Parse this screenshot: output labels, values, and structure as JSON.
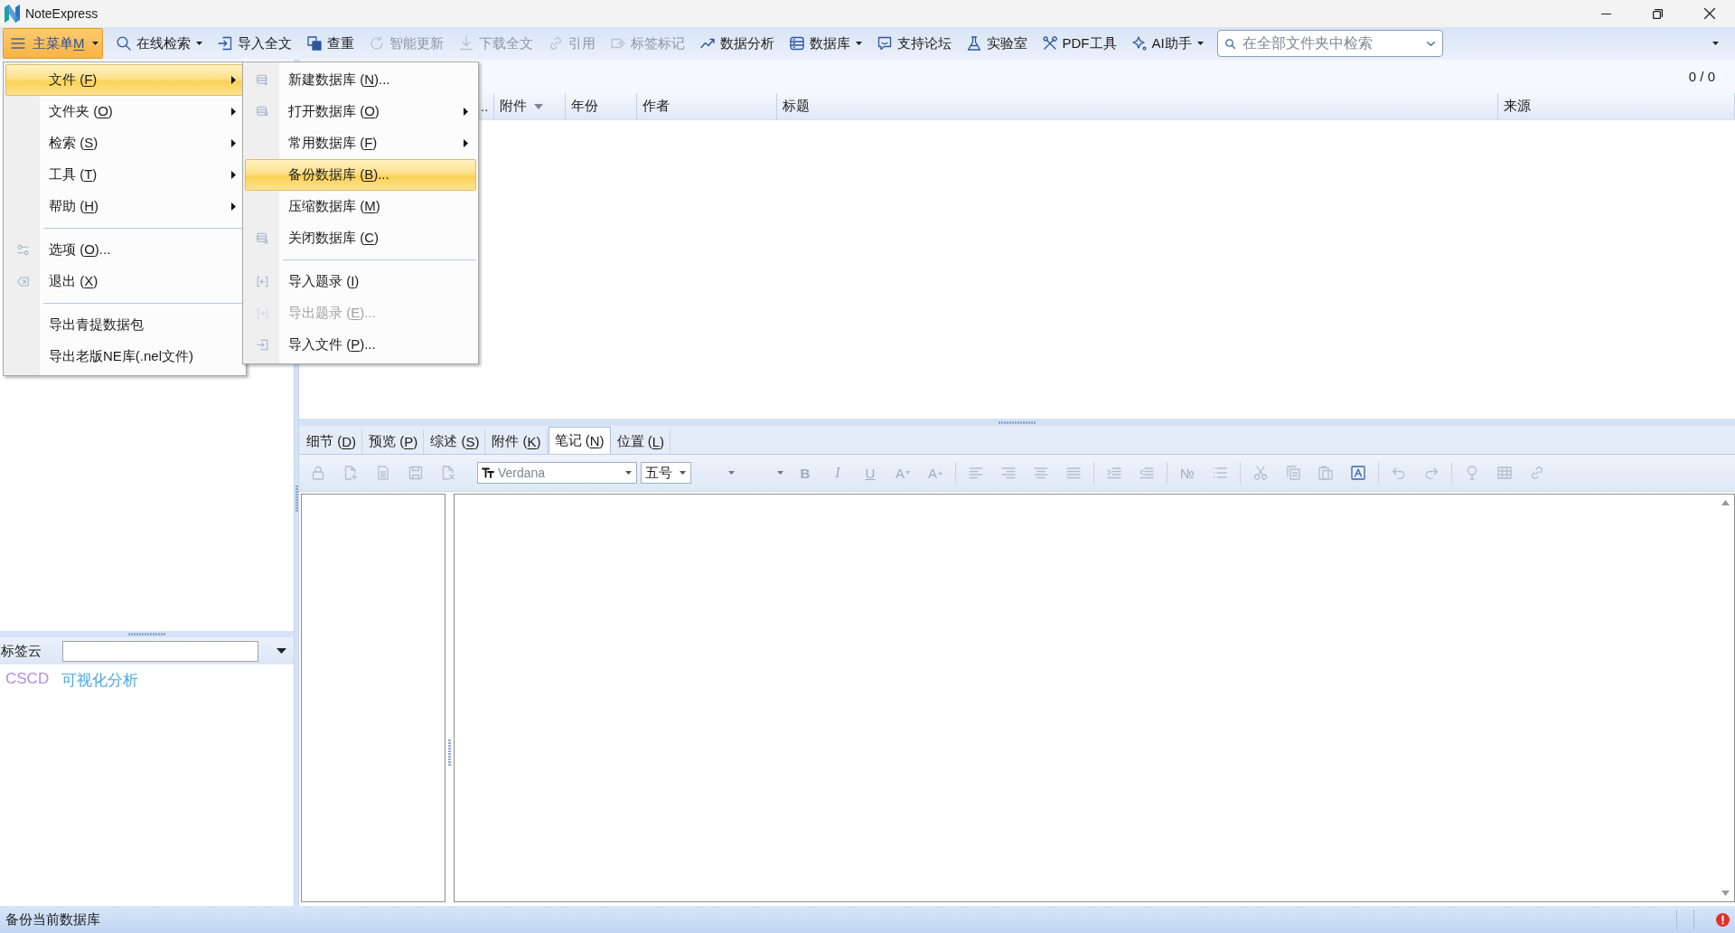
{
  "window": {
    "title": "NoteExpress"
  },
  "toolbar": {
    "items": [
      {
        "label": "主菜单",
        "accesskey": "M",
        "dropdown": true,
        "selected": true,
        "disabled": false
      },
      {
        "label": "在线检索",
        "dropdown": true,
        "selected": false,
        "disabled": false
      },
      {
        "label": "导入全文",
        "dropdown": false,
        "selected": false,
        "disabled": false
      },
      {
        "label": "查重",
        "dropdown": false,
        "selected": false,
        "disabled": false
      },
      {
        "label": "智能更新",
        "dropdown": false,
        "selected": false,
        "disabled": true
      },
      {
        "label": "下载全文",
        "dropdown": false,
        "selected": false,
        "disabled": true
      },
      {
        "label": "引用",
        "dropdown": false,
        "selected": false,
        "disabled": true
      },
      {
        "label": "标签标记",
        "dropdown": false,
        "selected": false,
        "disabled": true
      },
      {
        "label": "数据分析",
        "dropdown": false,
        "selected": false,
        "disabled": false
      },
      {
        "label": "数据库",
        "dropdown": true,
        "selected": false,
        "disabled": false
      },
      {
        "label": "支持论坛",
        "dropdown": false,
        "selected": false,
        "disabled": false
      },
      {
        "label": "实验室",
        "dropdown": false,
        "selected": false,
        "disabled": false
      },
      {
        "label": "PDF工具",
        "dropdown": false,
        "selected": false,
        "disabled": false
      },
      {
        "label": "AI助手",
        "dropdown": true,
        "selected": false,
        "disabled": false
      }
    ],
    "search": {
      "placeholder": "在全部文件夹中检索"
    }
  },
  "main_menu": {
    "sections": [
      {
        "items": [
          {
            "label": "文件 (F)",
            "submenu": true,
            "selected": true
          },
          {
            "label": "文件夹 (O)",
            "submenu": true,
            "selected": false
          },
          {
            "label": "检索 (S)",
            "submenu": true,
            "selected": false
          },
          {
            "label": "工具 (T)",
            "submenu": true,
            "selected": false
          },
          {
            "label": "帮助 (H)",
            "submenu": true,
            "selected": false
          }
        ]
      },
      {
        "items": [
          {
            "label": "选项 (O)...",
            "submenu": false,
            "selected": false
          },
          {
            "label": "退出 (X)",
            "submenu": false,
            "selected": false
          }
        ]
      },
      {
        "items": [
          {
            "label": "导出青提数据包",
            "submenu": false,
            "selected": false
          },
          {
            "label": "导出老版NE库(.nel文件)",
            "submenu": false,
            "selected": false
          }
        ]
      }
    ]
  },
  "submenu": {
    "sections": [
      {
        "items": [
          {
            "label": "新建数据库 (N)...",
            "submenu": false,
            "selected": false,
            "disabled": false
          },
          {
            "label": "打开数据库 (O)",
            "submenu": true,
            "selected": false,
            "disabled": false
          },
          {
            "label": "常用数据库 (F)",
            "submenu": true,
            "selected": false,
            "disabled": false
          },
          {
            "label": "备份数据库 (B)...",
            "submenu": false,
            "selected": true,
            "disabled": false
          },
          {
            "label": "压缩数据库 (M)",
            "submenu": false,
            "selected": false,
            "disabled": false
          },
          {
            "label": "关闭数据库 (C)",
            "submenu": false,
            "selected": false,
            "disabled": false
          }
        ]
      },
      {
        "items": [
          {
            "label": "导入题录 (I)",
            "submenu": false,
            "selected": false,
            "disabled": false
          },
          {
            "label": "导出题录 (E)...",
            "submenu": false,
            "selected": false,
            "disabled": true
          },
          {
            "label": "导入文件 (P)...",
            "submenu": false,
            "selected": false,
            "disabled": false
          }
        ]
      }
    ]
  },
  "library": {
    "count": "0 / 0",
    "columns": [
      {
        "label": "..",
        "dropdown": false
      },
      {
        "label": "附件",
        "dropdown": true
      },
      {
        "label": "年份",
        "dropdown": false
      },
      {
        "label": "作者",
        "dropdown": false
      },
      {
        "label": "标题",
        "dropdown": false
      },
      {
        "label": "来源",
        "dropdown": false
      }
    ]
  },
  "preview": {
    "tabs": [
      {
        "label": "细节 (D)",
        "selected": false
      },
      {
        "label": "预览 (P)",
        "selected": false
      },
      {
        "label": "综述 (S)",
        "selected": false
      },
      {
        "label": "附件 (K)",
        "selected": false
      },
      {
        "label": "笔记 (N)",
        "selected": true
      },
      {
        "label": "位置 (L)",
        "selected": false
      }
    ],
    "editor_toolbar": {
      "groups": [
        {
          "items": [
            {
              "kind": "icon",
              "disabled": true
            },
            {
              "kind": "icon",
              "disabled": true
            },
            {
              "kind": "icon",
              "disabled": true
            },
            {
              "kind": "icon",
              "disabled": true
            },
            {
              "kind": "icon",
              "disabled": true
            },
            {
              "kind": "font",
              "value": "Verdana",
              "disabled": true
            },
            {
              "kind": "size",
              "value": "五号",
              "disabled": false
            },
            {
              "kind": "caret",
              "disabled": true
            },
            {
              "kind": "caret",
              "disabled": true
            },
            {
              "kind": "bold",
              "label": "B",
              "disabled": true
            },
            {
              "kind": "italic",
              "label": "I",
              "disabled": true
            },
            {
              "kind": "underline",
              "label": "U",
              "disabled": true
            },
            {
              "kind": "shrink",
              "label": "A",
              "disabled": true
            },
            {
              "kind": "grow",
              "label": "A",
              "disabled": true
            }
          ]
        },
        {
          "items": [
            {
              "kind": "icon",
              "disabled": true
            },
            {
              "kind": "icon",
              "disabled": true
            },
            {
              "kind": "icon",
              "disabled": true
            },
            {
              "kind": "icon",
              "disabled": true
            }
          ]
        },
        {
          "items": [
            {
              "kind": "icon",
              "disabled": true
            },
            {
              "kind": "icon",
              "disabled": true
            }
          ]
        },
        {
          "items": [
            {
              "kind": "numbered",
              "label": "№",
              "disabled": true
            },
            {
              "kind": "icon",
              "disabled": true
            }
          ]
        },
        {
          "items": [
            {
              "kind": "icon",
              "disabled": true
            },
            {
              "kind": "icon",
              "disabled": true
            },
            {
              "kind": "icon",
              "disabled": true
            },
            {
              "kind": "icon",
              "disabled": false
            }
          ]
        },
        {
          "items": [
            {
              "kind": "icon",
              "disabled": true
            },
            {
              "kind": "icon",
              "disabled": true
            }
          ]
        },
        {
          "items": [
            {
              "kind": "icon",
              "disabled": true
            },
            {
              "kind": "icon",
              "disabled": true
            },
            {
              "kind": "icon",
              "disabled": true
            }
          ]
        }
      ]
    }
  },
  "tag_cloud": {
    "label": "标签云",
    "tags": [
      {
        "label": "CSCD",
        "color": "#b18de0"
      },
      {
        "label": "可视化分析",
        "color": "#4ba7e3"
      }
    ]
  },
  "status_bar": {
    "text": "备份当前数据库"
  }
}
